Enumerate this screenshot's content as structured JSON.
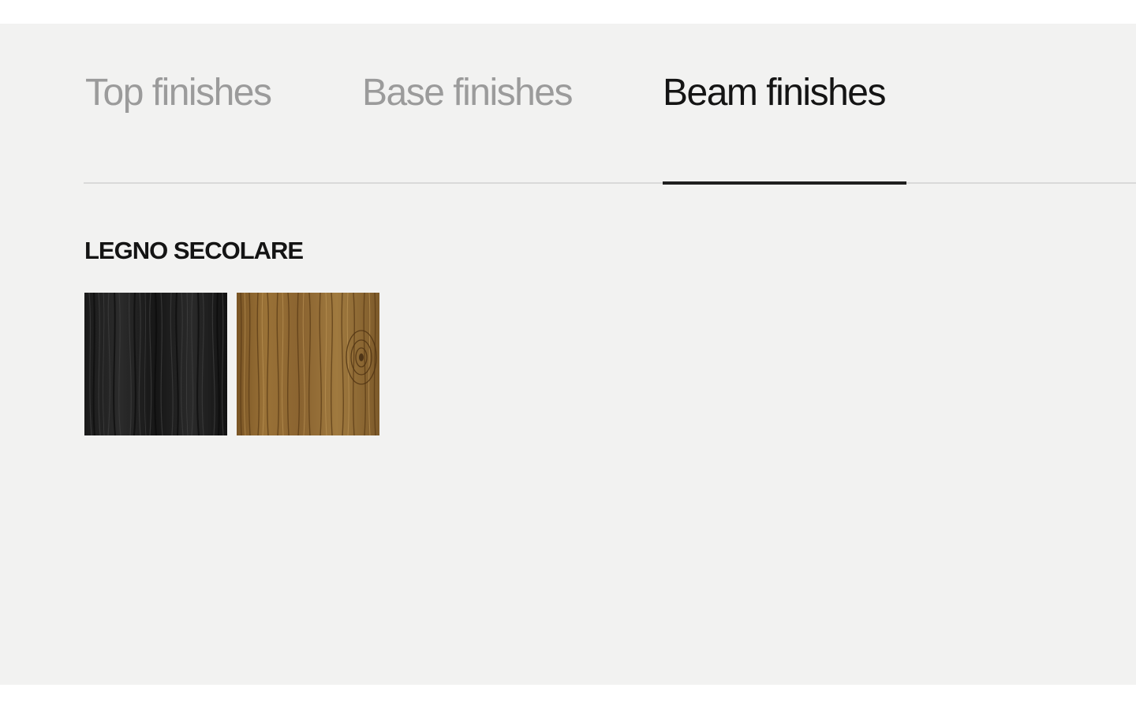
{
  "tabs": [
    {
      "label": "Top finishes",
      "active": false
    },
    {
      "label": "Base finishes",
      "active": false
    },
    {
      "label": "Beam finishes",
      "active": true
    }
  ],
  "finish_group": {
    "title": "LEGNO SECOLARE",
    "swatches": [
      {
        "icon": "dark-wood-texture",
        "base_color": "#1f1f1f"
      },
      {
        "icon": "natural-oak-texture",
        "base_color": "#8b6532"
      }
    ]
  }
}
